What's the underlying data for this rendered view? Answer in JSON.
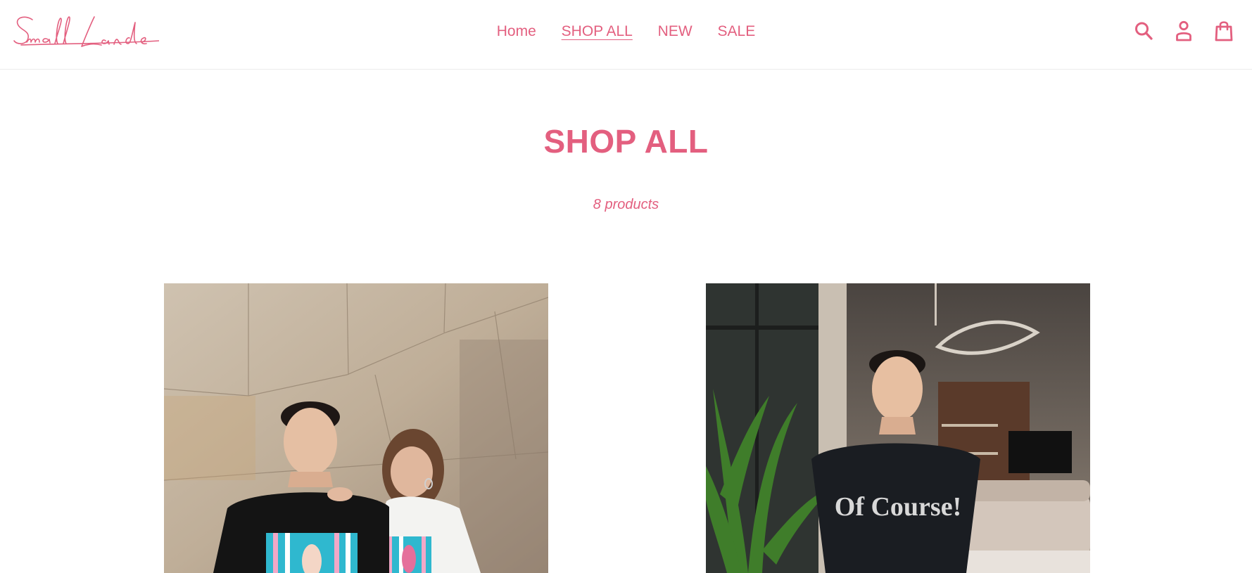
{
  "brand": {
    "logo_text": "Small Lande",
    "color": "#e35f7f"
  },
  "nav": {
    "items": [
      {
        "label": "Home",
        "active": false
      },
      {
        "label": "SHOP ALL",
        "active": true
      },
      {
        "label": "NEW",
        "active": false
      },
      {
        "label": "SALE",
        "active": false
      }
    ]
  },
  "header_icons": [
    {
      "name": "search-icon"
    },
    {
      "name": "account-icon"
    },
    {
      "name": "cart-icon"
    }
  ],
  "collection": {
    "title": "SHOP ALL",
    "count_text": "8 products"
  },
  "products": [
    {
      "image": "product-image-family-tshirt",
      "description": "Two people wearing matching printed T-shirts in front of a stone wall"
    },
    {
      "image": "product-image-of-course-tshirt",
      "description": "Person wearing black Of Course T-shirt in a living room"
    }
  ],
  "product_print_text": "Of Course!"
}
